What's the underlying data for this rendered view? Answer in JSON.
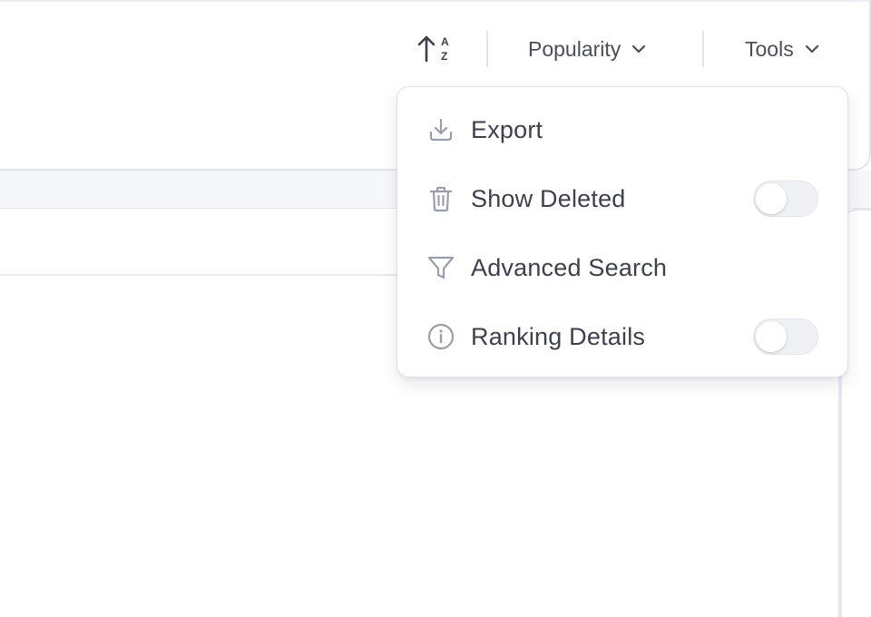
{
  "toolbar": {
    "sort_icon": "sort-alpha-ascending-icon",
    "sort_letters": {
      "top": "A",
      "bottom": "Z"
    },
    "popularity_label": "Popularity",
    "tools_label": "Tools"
  },
  "tools_menu": {
    "open": true,
    "items": [
      {
        "label": "Export",
        "icon": "download-icon",
        "has_toggle": false
      },
      {
        "label": "Show Deleted",
        "icon": "trash-icon",
        "has_toggle": true,
        "toggle_on": false
      },
      {
        "label": "Advanced Search",
        "icon": "filter-icon",
        "has_toggle": false
      },
      {
        "label": "Ranking Details",
        "icon": "info-icon",
        "has_toggle": true,
        "toggle_on": false
      }
    ]
  },
  "colors": {
    "text": "#3d414c",
    "icon_gray": "#9a9ea8",
    "border": "#e1e3ea",
    "toggle_off": "#f0f1f4"
  }
}
